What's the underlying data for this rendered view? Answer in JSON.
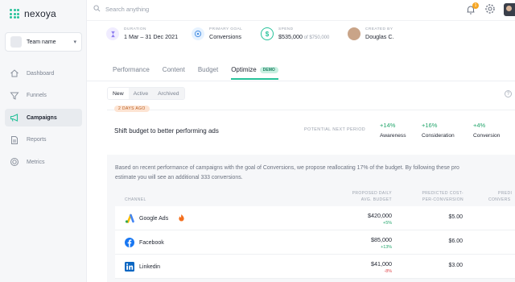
{
  "app": {
    "name": "nexoya"
  },
  "team": {
    "name": "Team name"
  },
  "sidebar": {
    "items": [
      {
        "label": "Dashboard",
        "icon": "home-icon",
        "active": false
      },
      {
        "label": "Funnels",
        "icon": "funnel-icon",
        "active": false
      },
      {
        "label": "Campaigns",
        "icon": "megaphone-icon",
        "active": true
      },
      {
        "label": "Reports",
        "icon": "report-icon",
        "active": false
      },
      {
        "label": "Metrics",
        "icon": "metrics-icon",
        "active": false
      }
    ]
  },
  "search": {
    "placeholder": "Search anything"
  },
  "notifications": {
    "count": "1"
  },
  "meta": {
    "duration": {
      "label": "DURATION",
      "value": "1 Mar – 31 Dec 2021"
    },
    "goal": {
      "label": "PRIMARY GOAL",
      "value": "Conversions"
    },
    "spend": {
      "label": "SPEND",
      "value": "$535,000",
      "suffix": " of $750,000"
    },
    "created": {
      "label": "CREATED BY",
      "value": "Douglas C."
    }
  },
  "tabs": [
    "Performance",
    "Content",
    "Budget",
    "Optimize"
  ],
  "demo_badge": "DEMO",
  "subtabs": [
    "New",
    "Active",
    "Archived"
  ],
  "help": "?",
  "optimization": {
    "age": "2 DAYS AGO",
    "title": "Shift budget to better performing ads",
    "potential_label": "POTENTIAL NEXT PERIOD",
    "impacts": [
      {
        "value": "+14%",
        "label": "Awareness"
      },
      {
        "value": "+16%",
        "label": "Consideration"
      },
      {
        "value": "+4%",
        "label": "Conversion"
      }
    ],
    "description_1": "Based on recent performance of campaigns with the goal of Conversions, we propose reallocating 17% of the budget. By following these pro",
    "description_2": "estimate you will see an additional 333 conversions."
  },
  "table": {
    "headers": {
      "channel": "CHANNEL",
      "budget_1": "PROPOSED DAILY",
      "budget_2": "AVG. BUDGET",
      "cpc_1": "PREDICTED COST-",
      "cpc_2": "PER-CONVERSION",
      "conv_1": "PREDI",
      "conv_2": "CONVERS"
    },
    "rows": [
      {
        "channel": "Google Ads",
        "icon": "google-ads-icon",
        "budget": "$420,000",
        "delta": "+5%",
        "delta_color": "#22a56b",
        "cpc": "$5.00"
      },
      {
        "channel": "Facebook",
        "icon": "facebook-icon",
        "budget": "$85,000",
        "delta": "+13%",
        "delta_color": "#22a56b",
        "cpc": "$6.00"
      },
      {
        "channel": "Linkedin",
        "icon": "linkedin-icon",
        "budget": "$41,000",
        "delta": "-8%",
        "delta_color": "#e0474c",
        "cpc": "$3.00"
      }
    ]
  },
  "colors": {
    "accent": "#27c29a",
    "positive": "#22a56b",
    "negative": "#e0474c"
  }
}
